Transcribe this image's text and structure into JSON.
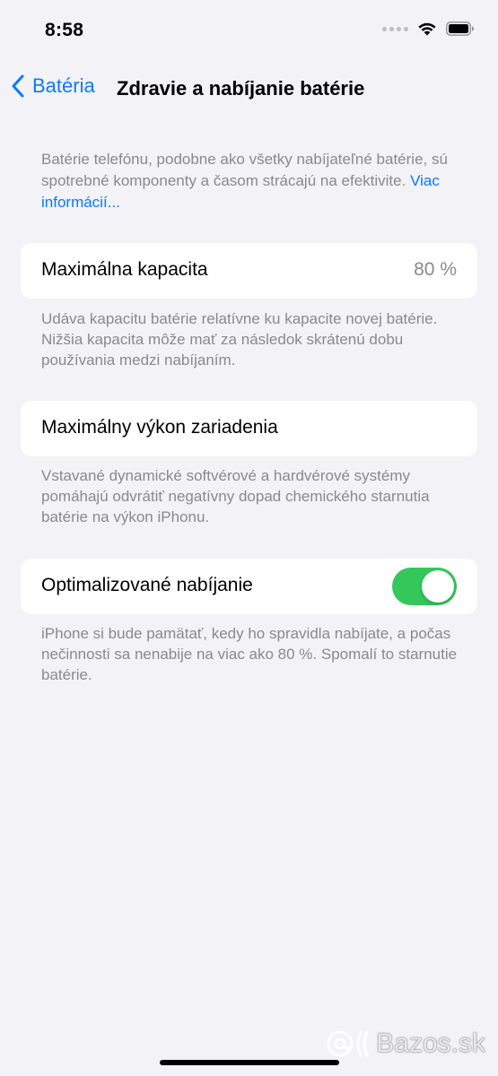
{
  "status_bar": {
    "time": "8:58",
    "icons": [
      "signal-dots-icon",
      "wifi-icon",
      "battery-icon"
    ]
  },
  "nav": {
    "back_label": "Batéria",
    "title": "Zdravie a nabíjanie batérie"
  },
  "intro": {
    "text": "Batérie telefónu, podobne ako všetky nabíjateľné batérie, sú spotrebné komponenty a časom strácajú na efektivite. ",
    "link": "Viac informácií..."
  },
  "max_capacity": {
    "label": "Maximálna kapacita",
    "value": "80 %",
    "footnote": "Udáva kapacitu batérie relatívne ku kapacite novej batérie. Nižšia kapacita môže mať za následok skrátenú dobu používania medzi nabíjaním."
  },
  "peak_performance": {
    "label": "Maximálny výkon zariadenia",
    "footnote": "Vstavané dynamické softvérové a hardvérové systémy pomáhajú odvrátiť negatívny dopad chemického starnutia batérie na výkon iPhonu."
  },
  "optimized_charging": {
    "label": "Optimalizované nabíjanie",
    "enabled": true,
    "footnote": "iPhone si bude pamätať, kedy ho spravidla nabíjate, a počas nečinnosti sa nenabije na viac ako 80 %. Spomalí to starnutie batérie."
  },
  "watermark": {
    "text": "Bazos.sk"
  },
  "colors": {
    "background": "#f2f2f7",
    "accent": "#0a7aff",
    "toggle_on": "#34c759",
    "secondary_text": "#8a8a8e"
  }
}
